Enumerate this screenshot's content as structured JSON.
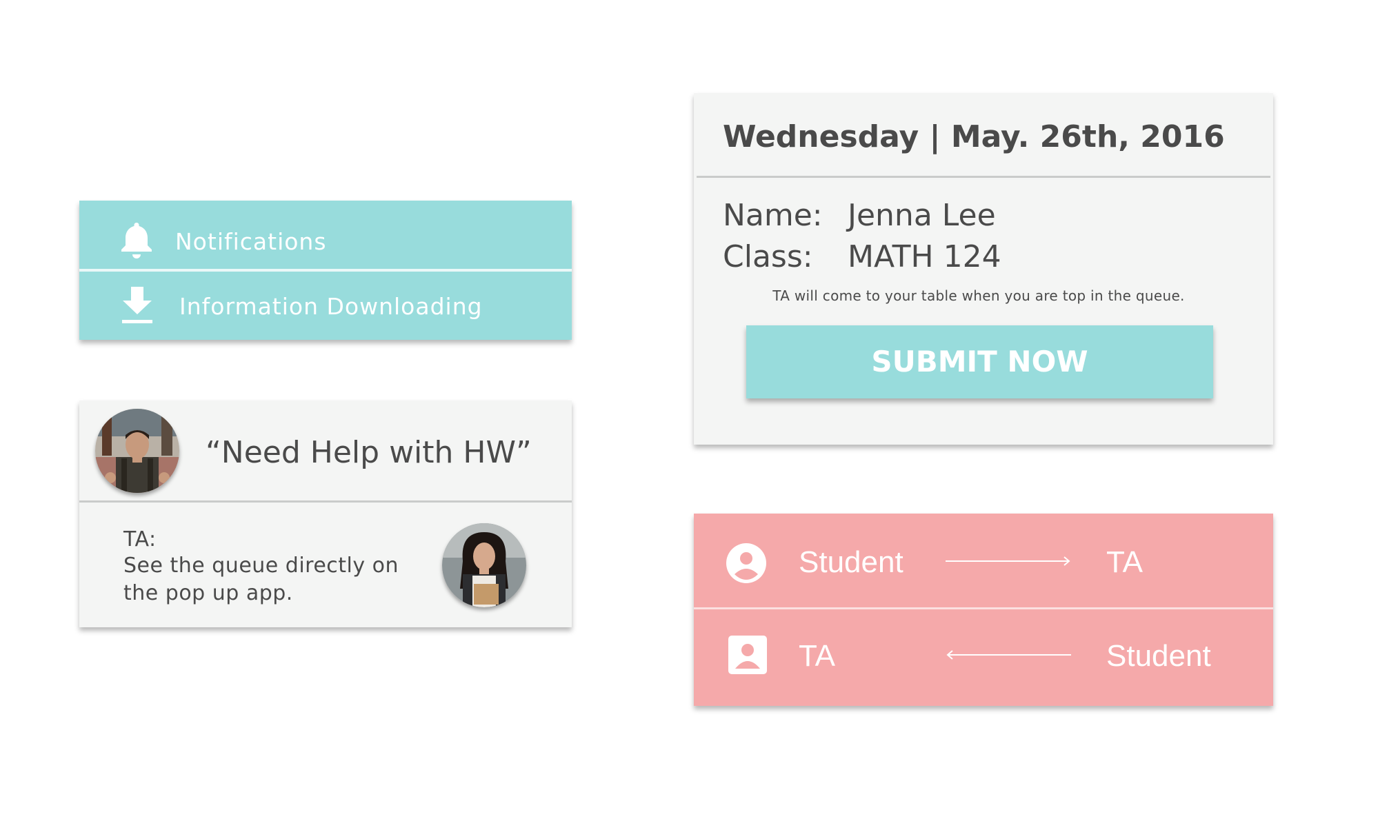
{
  "notifications": {
    "items": [
      {
        "icon": "bell-icon",
        "label": "Notifications"
      },
      {
        "icon": "download-icon",
        "label": "Information Downloading"
      }
    ],
    "color": "#98dcdc"
  },
  "request": {
    "quote": "“Need Help with HW”",
    "ta_label": "TA:",
    "ta_text": "See the queue directly on the pop up app."
  },
  "submit_card": {
    "date": "Wednesday | May. 26th, 2016",
    "name_label": "Name:",
    "name_value": "Jenna Lee",
    "class_label": "Class:",
    "class_value": "MATH 124",
    "note": "TA will come to your table when you are top in the queue.",
    "button_label": "SUBMIT NOW"
  },
  "roles": {
    "color": "#f5a9aa",
    "rows": [
      {
        "icon": "account-circle-icon",
        "from": "Student",
        "to": "TA",
        "direction": "right"
      },
      {
        "icon": "account-box-icon",
        "from": "TA",
        "to": "Student",
        "direction": "left"
      }
    ]
  }
}
